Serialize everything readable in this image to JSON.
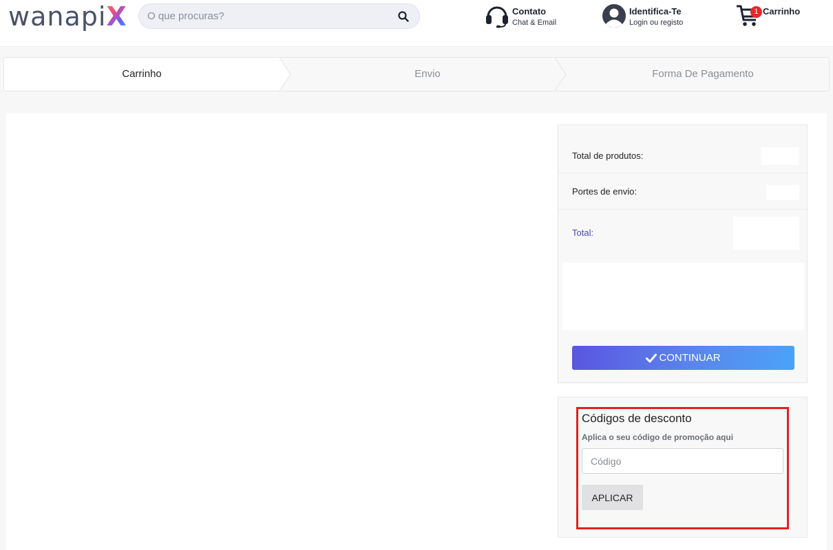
{
  "header": {
    "logo_text": "wanapi",
    "logo_x": "X",
    "search": {
      "placeholder": "O que procuras?"
    },
    "contact": {
      "title": "Contato",
      "subtitle": "Chat & Email"
    },
    "account": {
      "title": "Identifica-Te",
      "subtitle": "Login ou registo"
    },
    "cart": {
      "title": "Carrinho",
      "count": "1"
    }
  },
  "steps": [
    {
      "label": "Carrinho",
      "active": true
    },
    {
      "label": "Envio",
      "active": false
    },
    {
      "label": "Forma De Pagamento",
      "active": false
    }
  ],
  "summary": {
    "products_label": "Total de produtos:",
    "shipping_label": "Portes de envio:",
    "total_label": "Total:",
    "continue_label": "CONTINUAR"
  },
  "discount": {
    "title": "Códigos de desconto",
    "subtitle": "Aplica o seu código de promoção aqui",
    "input_placeholder": "Código",
    "apply_label": "APLICAR"
  },
  "colors": {
    "accent_start": "#5a56e0",
    "accent_end": "#4aa3f8",
    "badge": "#e8262b",
    "highlight_border": "#e4201f",
    "total_label": "#4b46c9"
  }
}
